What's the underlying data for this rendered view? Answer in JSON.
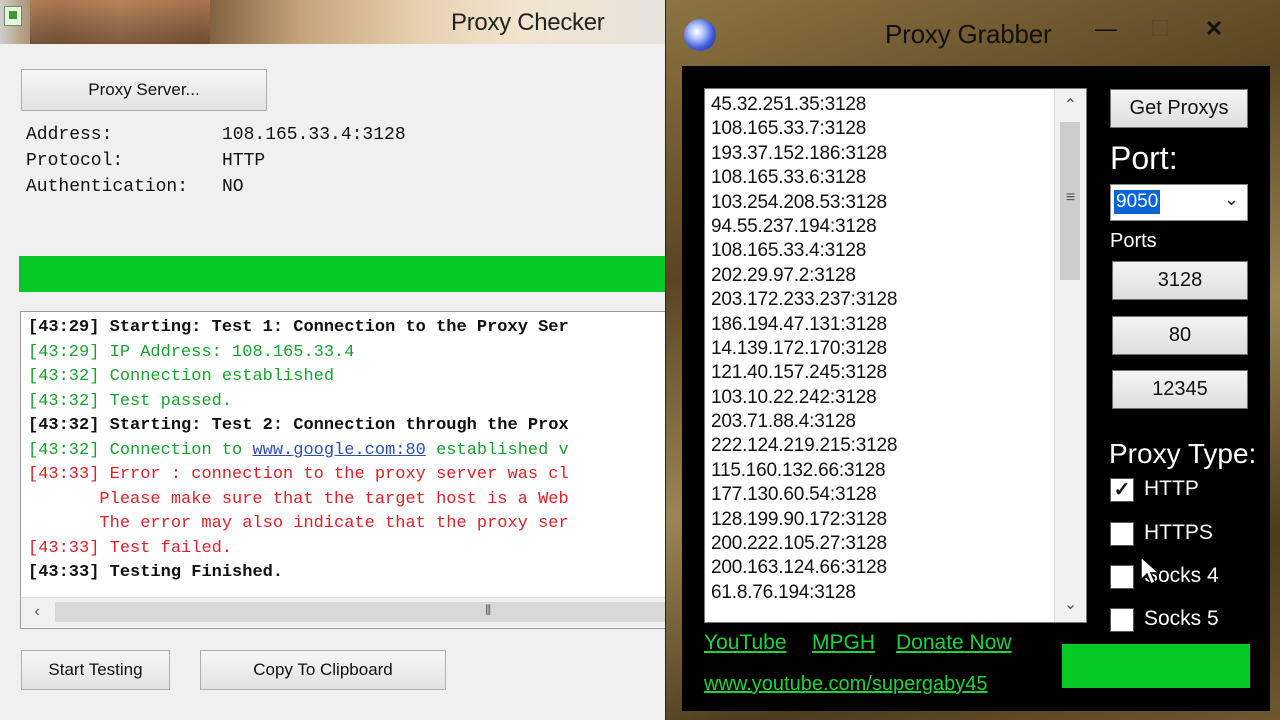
{
  "checker": {
    "title": "Proxy Checker",
    "proxy_server_button": "Proxy Server...",
    "fields": [
      {
        "key": "Address:",
        "value": "108.165.33.4:3128"
      },
      {
        "key": "Protocol:",
        "value": "HTTP"
      },
      {
        "key": "Authentication:",
        "value": "NO"
      }
    ],
    "progress_fraction": 1.0,
    "progress_color": "#06cb24",
    "log": [
      {
        "time": "[43:29]",
        "text": " Starting: Test 1: Connection to the Proxy Ser"
      },
      {
        "time": "[43:29]",
        "text": " IP Address: 108.165.33.4"
      },
      {
        "time": "[43:32]",
        "text": " Connection established"
      },
      {
        "time": "[43:32]",
        "text": " Test passed."
      },
      {
        "time": "[43:32]",
        "text": " Starting: Test 2: Connection through the Prox"
      },
      {
        "time": "[43:32]",
        "pre": " Connection to ",
        "link": "www.google.com:80",
        "post": " established v"
      },
      {
        "time": "[43:33]",
        "text": " Error : connection to the proxy server was cl"
      },
      {
        "time": "",
        "text": "       Please make sure that the target host is a Web"
      },
      {
        "time": "",
        "text": "       The error may also indicate that the proxy ser"
      },
      {
        "time": "[43:33]",
        "text": " Test failed."
      },
      {
        "time": "[43:33]",
        "text": " Testing Finished."
      }
    ],
    "start_button": "Start Testing",
    "copy_button": "Copy To Clipboard"
  },
  "grabber": {
    "title": "Proxy Grabber",
    "proxies": [
      "45.32.251.35:3128",
      "108.165.33.7:3128",
      "193.37.152.186:3128",
      "108.165.33.6:3128",
      "103.254.208.53:3128",
      "94.55.237.194:3128",
      "108.165.33.4:3128",
      "202.29.97.2:3128",
      "203.172.233.237:3128",
      "186.194.47.131:3128",
      "14.139.172.170:3128",
      "121.40.157.245:3128",
      "103.10.22.242:3128",
      "203.71.88.4:3128",
      "222.124.219.215:3128",
      "115.160.132.66:3128",
      "177.130.60.54:3128",
      "128.199.90.172:3128",
      "200.222.105.27:3128",
      "200.163.124.66:3128",
      "61.8.76.194:3128"
    ],
    "get_proxys_button": "Get Proxys",
    "port_label": "Port:",
    "port_value": "9050",
    "ports_label": "Ports",
    "port_buttons": [
      "3128",
      "80",
      "12345"
    ],
    "proxy_type_label": "Proxy Type:",
    "proxy_types": [
      {
        "label": "HTTP",
        "checked": true
      },
      {
        "label": "HTTPS",
        "checked": false
      },
      {
        "label": "Socks 4",
        "checked": false
      },
      {
        "label": "Socks 5",
        "checked": false
      }
    ],
    "links": {
      "youtube": "YouTube",
      "mpgh": "MPGH",
      "donate": "Donate Now",
      "url": "www.youtube.com/supergaby45"
    },
    "progress_color": "#06cb24",
    "link_color": "#1ad43a",
    "close_glyph": "✕",
    "min_glyph": "—",
    "max_glyph": "☐"
  }
}
